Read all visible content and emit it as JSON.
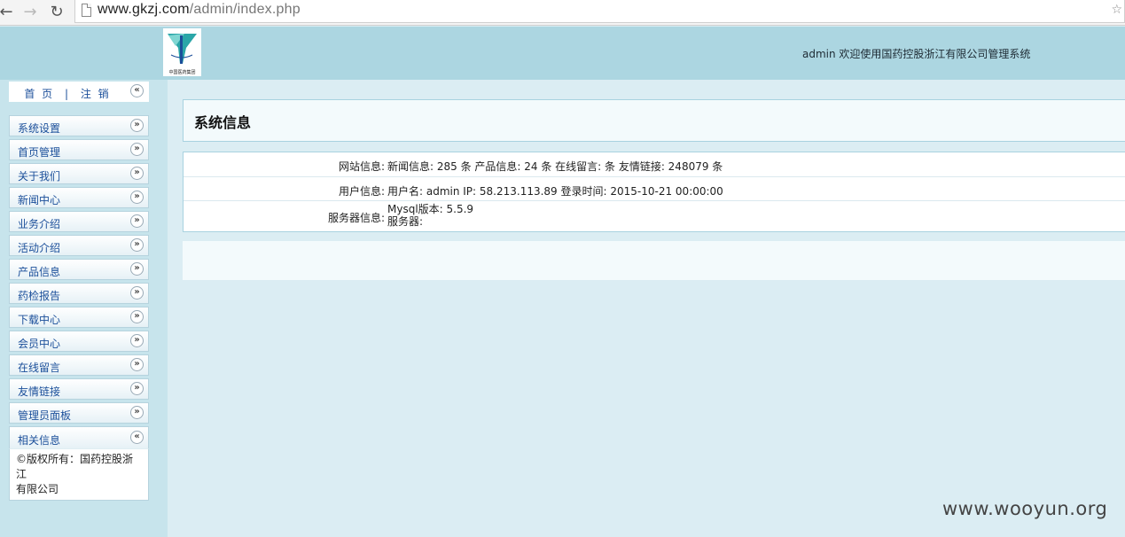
{
  "browser": {
    "url_host": "www.gkzj.com",
    "url_path": "/admin/index.php"
  },
  "header": {
    "logo_text": "中国医药集团",
    "welcome": "admin 欢迎使用国药控股浙江有限公司管理系统"
  },
  "sidebar": {
    "home": "首 页",
    "separator": "|",
    "logout": "注 销",
    "collapse_glyph": "«",
    "expand_glyph": "»",
    "items": [
      {
        "label": "系统设置"
      },
      {
        "label": "首页管理"
      },
      {
        "label": "关于我们"
      },
      {
        "label": "新闻中心"
      },
      {
        "label": "业务介绍"
      },
      {
        "label": "活动介绍"
      },
      {
        "label": "产品信息"
      },
      {
        "label": "药检报告"
      },
      {
        "label": "下载中心"
      },
      {
        "label": "会员中心"
      },
      {
        "label": "在线留言"
      },
      {
        "label": "友情链接"
      },
      {
        "label": "管理员面板"
      }
    ],
    "related": {
      "label": "相关信息",
      "copyright_line1": "©版权所有：国药控股浙江",
      "copyright_line2": "有限公司"
    }
  },
  "main": {
    "title": "系统信息",
    "rows": [
      {
        "key": "网站信息:",
        "value": "新闻信息: 285 条  产品信息: 24 条  在线留言:  条  友情链接: 248079 条"
      },
      {
        "key": "用户信息:",
        "value": "用户名: admin  IP: 58.213.113.89  登录时间: 2015-10-21 00:00:00"
      },
      {
        "key": "服务器信息:",
        "value": "Mysql版本: 5.5.9",
        "value2": "服务器:"
      }
    ]
  },
  "watermark": "www.wooyun.org",
  "colors": {
    "header_bg": "#acd6e1",
    "sidebar_bg": "#c7e4ec",
    "main_bg": "#dbedf3",
    "link": "#1b4f9a"
  }
}
